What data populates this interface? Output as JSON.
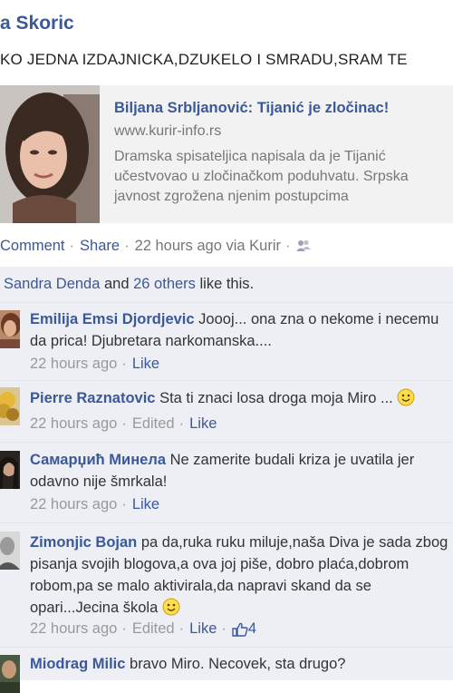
{
  "post": {
    "poster_name": "a Skoric",
    "status_text": "KO JEDNA IZDAJNICKA,DZUKELO I SMRADU,SRAM TE"
  },
  "attachment": {
    "title": "Biljana Srbljanović: Tijanić je zločinac!",
    "url": "www.kurir-info.rs",
    "description": "Dramska spisateljica napisala da je Tijanić učestvovao u zločinačkom poduhvatu. Srpska javnost zgrožena njenim postupcima"
  },
  "actions": {
    "comment": "Comment",
    "share": "Share",
    "time": "22 hours ago via Kurir"
  },
  "likes": {
    "first": "Sandra Denda",
    "and": " and ",
    "others": "26 others",
    "suffix": " like this."
  },
  "comments": [
    {
      "name": "Emilija Emsi Djordjevic",
      "text": "Joooj... ona zna o nekome i necemu da prica! Djubretara narkomanska....",
      "time": "22 hours ago",
      "edited": "",
      "like": "Like",
      "like_count": ""
    },
    {
      "name": "Pierre Raznatovic",
      "text": "Sta ti znaci losa droga moja Miro ...",
      "time": "22 hours ago",
      "edited": "Edited",
      "like": "Like",
      "like_count": ""
    },
    {
      "name": "Самарџић Минела",
      "text": "Ne zamerite budali kriza je uvatila jer odavno nije šmrkala!",
      "time": "22 hours ago",
      "edited": "",
      "like": "Like",
      "like_count": ""
    },
    {
      "name": "Zimonjic Bojan",
      "text": "pa da,ruka ruku miluje,naša Diva je sada zbog pisanja svojih blogova,a ova joj piše, dobro plaća,dobrom robom,pa se malo aktivirala,da napravi skand da se opari...Jecina škola",
      "time": "22 hours ago",
      "edited": "Edited",
      "like": "Like",
      "like_count": "4"
    },
    {
      "name": "Miodrag Milic",
      "text": "bravo Miro. Necovek, sta drugo?",
      "time": "",
      "edited": "",
      "like": "",
      "like_count": ""
    }
  ],
  "colors": {
    "link": "#3b5998",
    "ufi_background": "#edeff4",
    "meta": "#999999"
  }
}
